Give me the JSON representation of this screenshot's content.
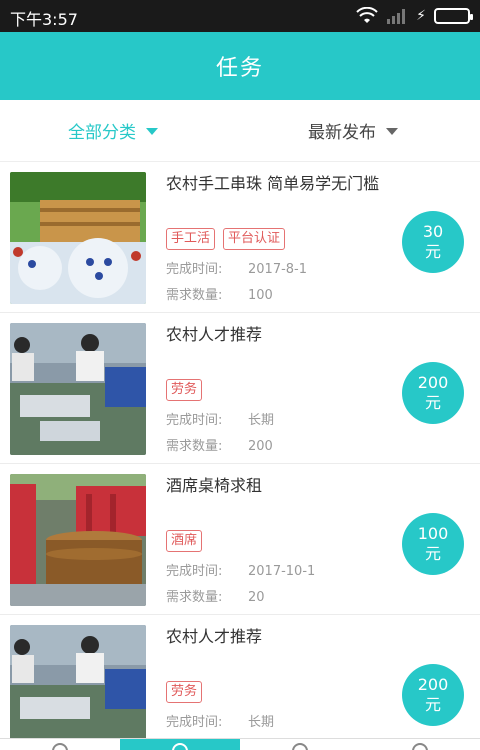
{
  "status_bar": {
    "time": "下午3:57",
    "icons": [
      "wifi-icon",
      "signal-icon",
      "charging-icon",
      "battery-icon"
    ]
  },
  "header": {
    "title": "任务"
  },
  "filters": {
    "category": "全部分类",
    "sort": "最新发布"
  },
  "labels": {
    "complete_time": "完成时间:",
    "quantity": "需求数量:"
  },
  "tasks": [
    {
      "title": "农村手工串珠 简单易学无门槛",
      "tags": [
        "手工活",
        "平台认证"
      ],
      "complete_time": "2017-8-1",
      "quantity": "100",
      "price": "30",
      "unit": "元"
    },
    {
      "title": "农村人才推荐",
      "tags": [
        "劳务"
      ],
      "complete_time": "长期",
      "quantity": "200",
      "price": "200",
      "unit": "元"
    },
    {
      "title": "酒席桌椅求租",
      "tags": [
        "酒席"
      ],
      "complete_time": "2017-10-1",
      "quantity": "20",
      "price": "100",
      "unit": "元"
    },
    {
      "title": "农村人才推荐",
      "tags": [
        "劳务"
      ],
      "complete_time": "长期",
      "price": "200",
      "unit": "元"
    }
  ],
  "colors": {
    "accent": "#27c8c8",
    "tag_red": "#e05a5a"
  }
}
